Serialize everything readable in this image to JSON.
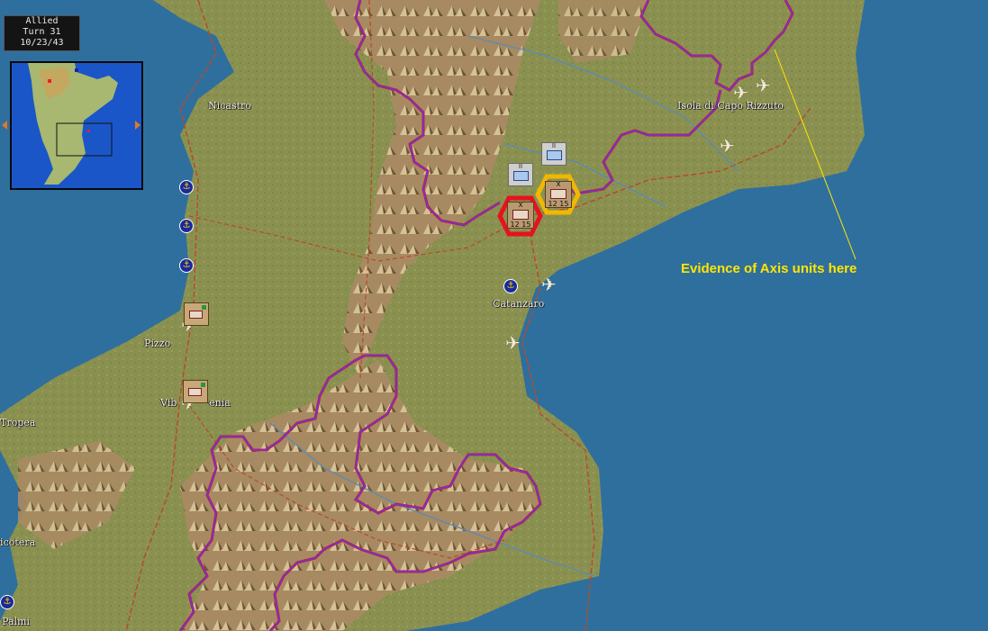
{
  "status": {
    "side": "Allied",
    "turn": "Turn 31",
    "date": "10/23/43"
  },
  "cities": {
    "nicastro": "Nicastro",
    "isola": "Isola di Capo Rizzuto",
    "catanzaro": "Catanzaro",
    "pizzo": "Pizzo",
    "vibo_part1": "Vib",
    "vibo_part2": "enia",
    "tropea": "Tropea",
    "nicotera": "icotera",
    "palmi": "Palmi"
  },
  "annotation": "Evidence of Axis units here",
  "units": {
    "allied_size": "II",
    "axis_size": "X",
    "axis_strength": "12 15"
  },
  "icons": {
    "port": "anchor-icon",
    "airfield": "airplane-icon"
  },
  "colors": {
    "sea": "#2f6f9e",
    "land": "#8a9150",
    "front_line_outer": "#c41a3a",
    "front_line_inner": "#5a3cff",
    "selected_hex": "#e8121e",
    "target_hex": "#f0b800",
    "annotation": "#ffe600"
  }
}
